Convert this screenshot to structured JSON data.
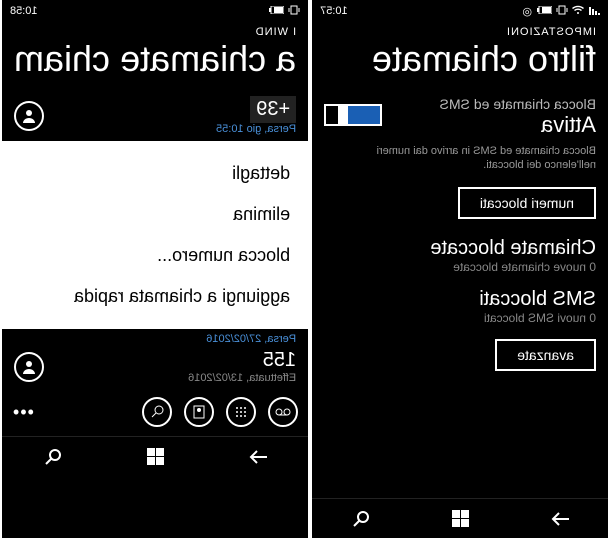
{
  "left": {
    "status": {
      "time": "10:57"
    },
    "header_small": "IMPOSTAZIONI",
    "header_large": "filtro chiamate",
    "block_label": "Blocca chiamate ed SMS",
    "toggle_value": "Attiva",
    "help_text": "Blocca chiamate ed SMS in arrivo dai numeri nell'elenco dei bloccati.",
    "btn_blocked_numbers": "numeri bloccati",
    "blocked_calls_title": "Chiamate bloccate",
    "blocked_calls_sub": "0 nuove chiamate bloccate",
    "blocked_sms_title": "SMS bloccati",
    "blocked_sms_sub": "0 nuovi SMS bloccati",
    "btn_advanced": "avanzate"
  },
  "right": {
    "status": {
      "time": "10:58"
    },
    "header_small": "I WIND",
    "header_large": "a chiamate chiam",
    "top_entry": {
      "number": "+39",
      "sub": "Persa, gio 10:55"
    },
    "menu": {
      "items": [
        {
          "label": "dettagli"
        },
        {
          "label": "elimina"
        },
        {
          "label": "blocca numero..."
        },
        {
          "label": "aggiungi a chiamata rapida"
        }
      ]
    },
    "lower": {
      "date": "Persa, 27/02/2016",
      "entry_number": "155",
      "entry_sub": "Effettuata, 13/02/2016"
    }
  }
}
